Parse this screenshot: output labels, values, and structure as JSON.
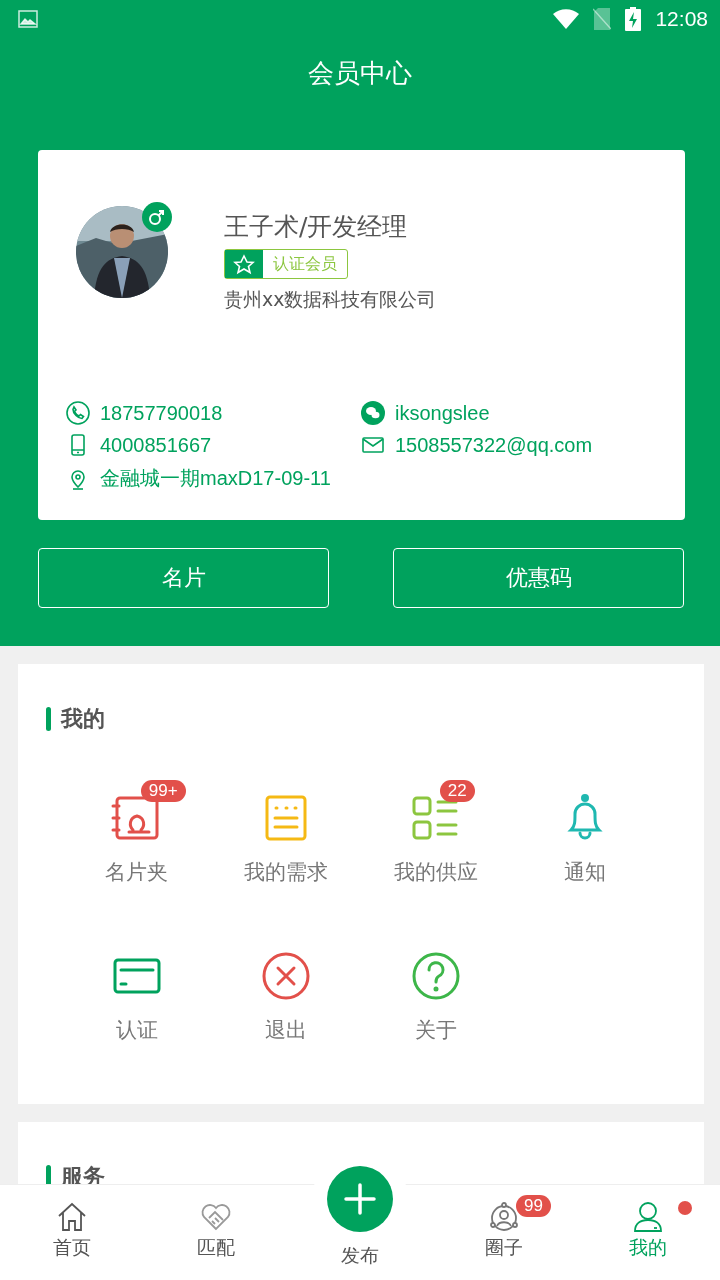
{
  "status_bar": {
    "time": "12:08"
  },
  "header": {
    "title": "会员中心"
  },
  "profile": {
    "name": "王子术/开发经理",
    "badge": "认证会员",
    "company": "贵州xx数据科技有限公司",
    "contacts": [
      {
        "kind": "phone",
        "text": "18757790018"
      },
      {
        "kind": "wechat",
        "text": "iksongslee"
      },
      {
        "kind": "mobile",
        "text": "4000851667"
      },
      {
        "kind": "email",
        "text": "1508557322@qq.com"
      },
      {
        "kind": "location",
        "text": "金融城一期maxD17-09-11"
      }
    ]
  },
  "actions": [
    "名片",
    "优惠码"
  ],
  "my_section": {
    "title": "我的",
    "items": [
      {
        "kind": "cards",
        "label": "名片夹",
        "badge": "99+",
        "color": "#e2504a"
      },
      {
        "kind": "needs",
        "label": "我的需求",
        "color": "#f5b914"
      },
      {
        "kind": "supply",
        "label": "我的供应",
        "badge": "22",
        "color": "#8cc63f"
      },
      {
        "kind": "bell",
        "label": "通知",
        "color": "#1fb8b0"
      },
      {
        "kind": "card",
        "label": "认证",
        "color": "#00a25d"
      },
      {
        "kind": "exit",
        "label": "退出",
        "color": "#e2504a"
      },
      {
        "kind": "help",
        "label": "关于",
        "color": "#3db649"
      }
    ]
  },
  "service_section": {
    "title": "服务"
  },
  "tab_bar": [
    {
      "kind": "home",
      "label": "首页",
      "selected": false
    },
    {
      "kind": "match",
      "label": "匹配",
      "selected": false
    },
    {
      "kind": "publish",
      "label": "发布",
      "selected": false
    },
    {
      "kind": "circle",
      "label": "圈子",
      "selected": false,
      "badge": "99"
    },
    {
      "kind": "me",
      "label": "我的",
      "selected": true,
      "dot": true
    }
  ]
}
